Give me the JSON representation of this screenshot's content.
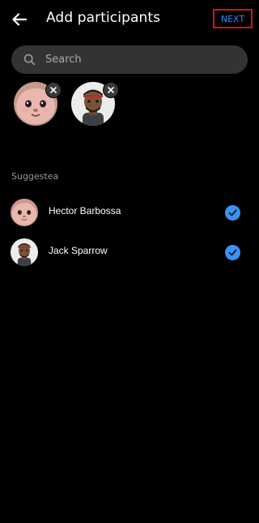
{
  "header": {
    "title": "Add participants",
    "next_label": "NEXT",
    "back_icon": "arrow-left-icon"
  },
  "search": {
    "placeholder": "Search",
    "value": "",
    "icon": "search-icon"
  },
  "selected_chips": [
    {
      "avatar": "pink-cat-face",
      "remove_icon": "close-icon"
    },
    {
      "avatar": "bearded-man-with-headband",
      "remove_icon": "close-icon"
    }
  ],
  "suggested": {
    "label": "Suggestea",
    "items": [
      {
        "name": "Hector Barbossa",
        "avatar": "pink-cat-face",
        "selected": true
      },
      {
        "name": "Jack Sparrow",
        "avatar": "bearded-man-with-headband",
        "selected": true
      }
    ]
  },
  "colors": {
    "background": "#000000",
    "search_bg": "#333333",
    "accent_blue": "#2f86ff",
    "check_blue": "#3a92f2",
    "highlight_red": "#d0141c",
    "secondary_text": "#9a9a9a"
  }
}
